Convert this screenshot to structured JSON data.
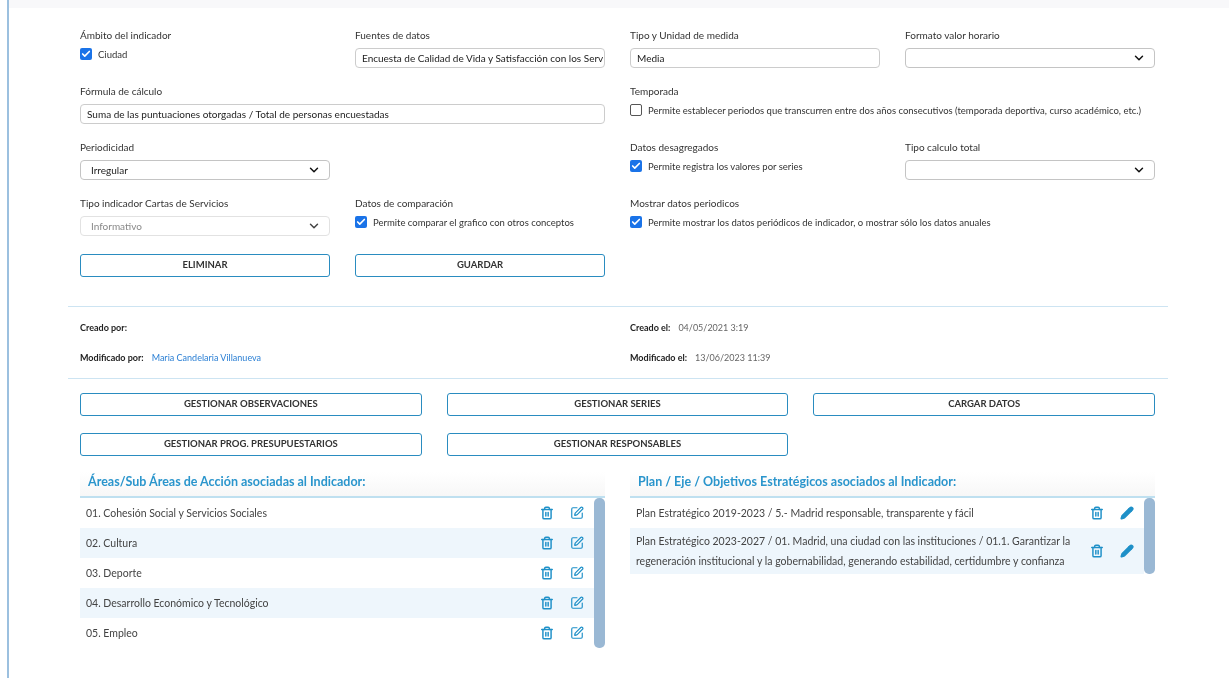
{
  "form_rows": [
    [
      {
        "kind": "checkbox",
        "label": "Ámbito del indicador",
        "text": "Ciudad",
        "checked": true
      },
      {
        "kind": "text",
        "label": "Fuentes de datos",
        "value": "Encuesta de Calidad de Vida y Satisfacción con los Serv"
      },
      {
        "kind": "text",
        "label": "Tipo y Unidad de medida",
        "value": "Media"
      },
      {
        "kind": "select",
        "label": "Formato valor horario",
        "disabled": false
      }
    ],
    [
      {
        "kind": "text",
        "label": "Fórmula de cálculo",
        "value": "Suma de las puntuaciones otorgadas / Total de personas encuestadas"
      },
      {
        "kind": "checkbox",
        "label": "Temporada",
        "text": "Permite establecer periodos que transcurren entre dos años consecutivos (temporada deportiva, curso académico, etc.)",
        "checked": false
      }
    ],
    [
      {
        "kind": "select",
        "label": "Periodicidad",
        "value": "Irregular",
        "disabled": false
      },
      {
        "kind": "checkbox",
        "label": "Datos desagregados",
        "text": "Permite registra los valores por series",
        "checked": true
      },
      {
        "kind": "select",
        "label": "Tipo calculo total",
        "disabled": false
      }
    ],
    [
      {
        "kind": "select",
        "label": "Tipo indicador Cartas de Servicios",
        "value": "Informativo",
        "disabled": true
      },
      {
        "kind": "checkbox",
        "label": "Datos de comparación",
        "text": "Permite comparar el grafico con otros conceptos",
        "checked": true
      },
      {
        "kind": "checkbox",
        "label": "Mostrar datos periodicos",
        "text": "Permite mostrar los datos periódicos de indicador, o mostrar sólo los datos anuales",
        "checked": true
      }
    ]
  ],
  "form_buttons": [
    "ELIMINAR",
    "GUARDAR"
  ],
  "meta": [
    {
      "label": "Creado por:"
    },
    {
      "label": "Creado el:",
      "value": "04/05/2021 3:19"
    },
    {
      "label": "Modificado por:",
      "value": "Maria Candelaria Villanueva",
      "link": true
    },
    {
      "label": "Modificado el:",
      "value": "13/06/2023 11:39"
    }
  ],
  "action_buttons": [
    "GESTIONAR OBSERVACIONES",
    "GESTIONAR SERIES",
    "CARGAR DATOS",
    "GESTIONAR PROG. PRESUPUESTARIOS",
    "GESTIONAR RESPONSABLES"
  ],
  "areas": {
    "title": "Áreas/Sub Áreas de Acción asociadas al Indicador:",
    "rows": [
      "01. Cohesión Social y Servicios Sociales",
      "02. Cultura",
      "03. Deporte",
      "04. Desarrollo Económico y Tecnológico",
      "05. Empleo"
    ]
  },
  "plans": {
    "title": "Plan / Eje / Objetivos Estratégicos asociados al Indicador:",
    "rows": [
      "Plan Estratégico 2019-2023 / 5.- Madrid responsable, transparente y fácil",
      "Plan Estratégico 2023-2027 / 01. Madrid, una ciudad con las instituciones / 01.1. Garantizar la regeneración institucional y la gobernabilidad, generando estabilidad, certidumbre y confianza"
    ]
  }
}
